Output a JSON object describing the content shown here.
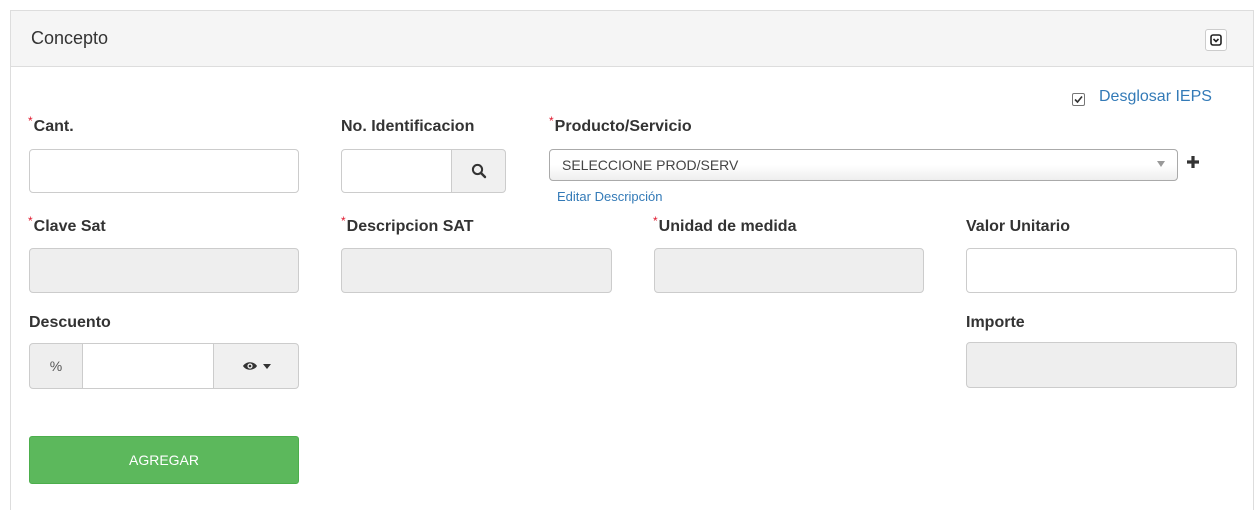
{
  "panel": {
    "title": "Concepto"
  },
  "desglosar": {
    "label": "Desglosar IEPS",
    "checked": true
  },
  "fields": {
    "cant": {
      "label": "Cant.",
      "value": ""
    },
    "no_identificacion": {
      "label": "No. Identificacion",
      "value": ""
    },
    "producto_servicio": {
      "label": "Producto/Servicio",
      "selected": "SELECCIONE PROD/SERV",
      "edit_link": "Editar Descripción"
    },
    "clave_sat": {
      "label": "Clave Sat",
      "value": ""
    },
    "descripcion_sat": {
      "label": "Descripcion SAT",
      "value": ""
    },
    "unidad_medida": {
      "label": "Unidad de medida",
      "value": ""
    },
    "valor_unitario": {
      "label": "Valor Unitario",
      "value": ""
    },
    "descuento": {
      "label": "Descuento",
      "addon": "%",
      "value": ""
    },
    "importe": {
      "label": "Importe",
      "value": ""
    }
  },
  "required_marker": "*",
  "add_button": {
    "label": "AGREGAR"
  },
  "colors": {
    "primary_link": "#337ab7",
    "success": "#5cb85c",
    "required": "#e0192e",
    "readonly_bg": "#eeeeee"
  },
  "icons": {
    "collapse": "collapse-toggle-icon",
    "search": "magnifier-icon",
    "plus": "plus-icon",
    "eye": "eye-icon",
    "caret": "caret-down-icon",
    "check": "checkmark-icon"
  }
}
